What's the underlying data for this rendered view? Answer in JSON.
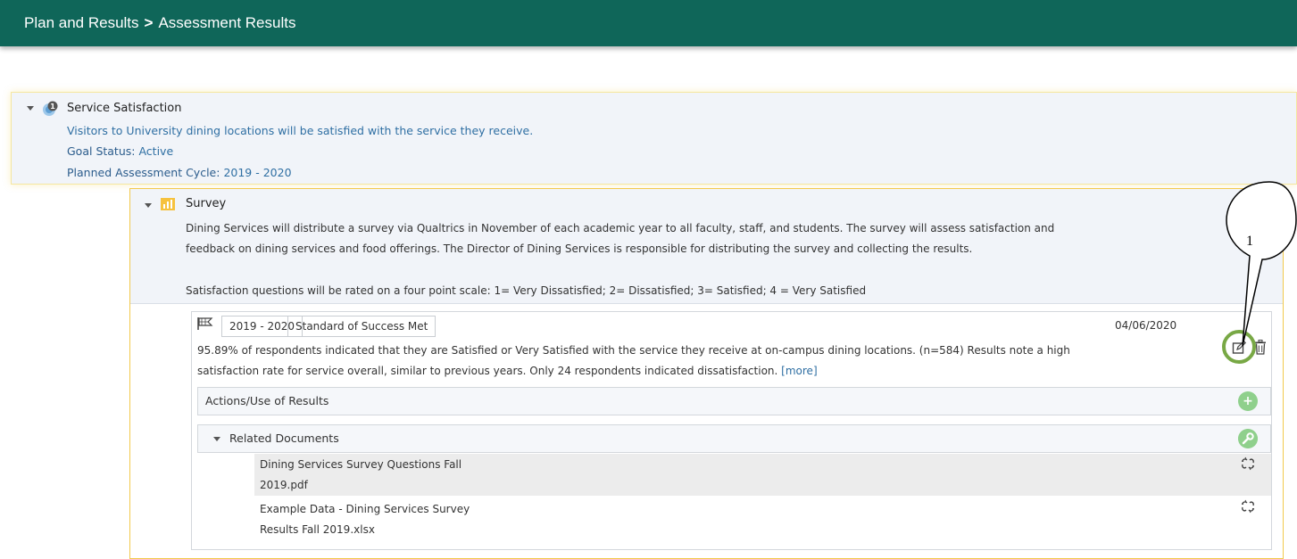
{
  "header": {
    "breadcrumb": [
      "Plan and Results",
      "Assessment Results"
    ],
    "separator": ">"
  },
  "goal": {
    "badge_count": "1",
    "title": "Service Satisfaction",
    "description": "Visitors to University dining locations will be satisfied with the service they receive.",
    "status_label": "Goal Status:",
    "status_value": "Active",
    "cycle_label": "Planned Assessment Cycle:",
    "cycle_value": "2019 - 2020"
  },
  "measure": {
    "title": "Survey",
    "description_lines": [
      "Dining Services will distribute a survey via Qualtrics in November of each academic year to all faculty, staff, and students. The survey will assess satisfaction and",
      "feedback on dining services and food offerings. The Director of Dining Services is responsible for distributing the survey and collecting the results.",
      "Satisfaction questions will be rated on a four point scale: 1= Very Dissatisfied; 2= Dissatisfied; 3= Satisfied; 4 = Very Satisfied"
    ]
  },
  "result": {
    "cycle_tag": "2019 - 2020",
    "status_tag": "Standard of Success Met",
    "date": "04/06/2020",
    "text_lines": [
      "95.89% of respondents indicated that they are Satisfied or Very Satisfied with the service they receive at on-campus dining locations. (n=584) Results note a high",
      "satisfaction rate for service overall, similar to previous years. Only 24 respondents indicated dissatisfaction."
    ],
    "more_link": "[more]"
  },
  "actions_panel": {
    "label": "Actions/Use of Results",
    "button": "+"
  },
  "documents_panel": {
    "label": "Related Documents",
    "documents": [
      {
        "line1": "Dining Services Survey Questions Fall",
        "line2": "2019.pdf"
      },
      {
        "line1": "Example Data - Dining Services Survey",
        "line2": "Results Fall 2019.xlsx"
      }
    ]
  },
  "annotation": {
    "callout_number": "1"
  },
  "colors": {
    "header_bg": "#0f6659",
    "link_blue": "#2f6fa3",
    "highlight_green": "#78a845",
    "measure_border": "#f2c94c"
  }
}
